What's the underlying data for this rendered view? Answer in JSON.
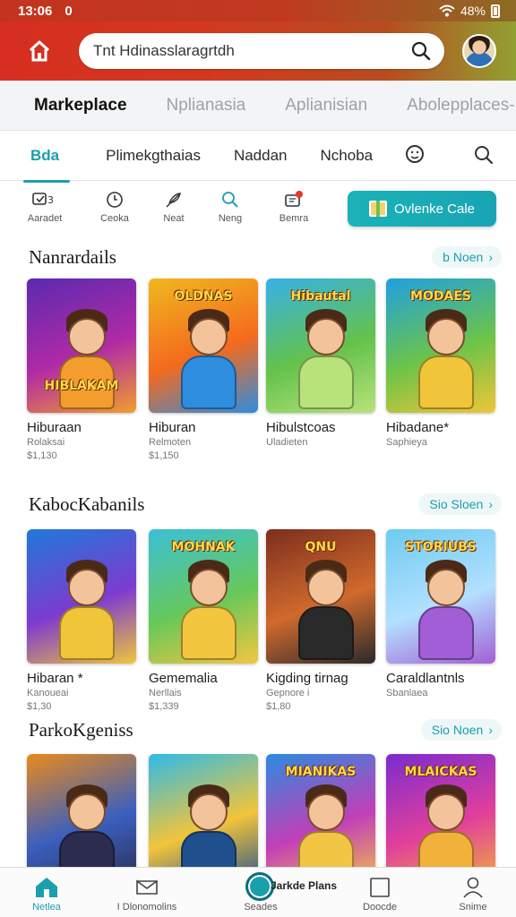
{
  "status_bar": {
    "time": "13:06",
    "signal_label": "0",
    "battery": "48%"
  },
  "search": {
    "value": "Tnt Hdinasslaragrtdh"
  },
  "section_tabs": [
    "Markeplace",
    "Nplianasia",
    "Aplianisian",
    "Abolepplaces-"
  ],
  "category_tabs": [
    "Bda",
    "Plimekgthaias",
    "Naddan",
    "Nchoba"
  ],
  "quick_actions": [
    {
      "label": "Aaradet",
      "icon": "ticket-icon"
    },
    {
      "label": "Ceoka",
      "icon": "clock-icon"
    },
    {
      "label": "Neat",
      "icon": "feather-icon"
    },
    {
      "label": "Neng",
      "icon": "search-icon"
    },
    {
      "label": "Bemra",
      "icon": "notification-icon"
    }
  ],
  "cta": {
    "label": "Ovlenke Cale"
  },
  "sections": [
    {
      "title": "Nanrardails",
      "see_more": "b Noen",
      "cards": [
        {
          "title": "Hiburaan",
          "subtitle": "Rolaksai",
          "price": "$1,130",
          "art": "HIBLAKAM",
          "theme": [
            "#5b2ab0",
            "#b02aa6",
            "#f29d2e"
          ]
        },
        {
          "title": "Hiburan",
          "subtitle": "Relmoten",
          "price": "$1,150",
          "art": "OLDNAS",
          "theme": [
            "#f0b81f",
            "#f46a1d",
            "#2f8de0"
          ]
        },
        {
          "title": "Hibulstcoas",
          "subtitle": "Uladieten",
          "price": "",
          "art": "Hibautal",
          "theme": [
            "#36b1e8",
            "#64c24b",
            "#b8e27a"
          ]
        },
        {
          "title": "Hibadane*",
          "subtitle": "Saphieya",
          "price": "",
          "art": "MODAES",
          "theme": [
            "#1fa0e0",
            "#6cc447",
            "#f0c53a"
          ]
        }
      ]
    },
    {
      "title": "KabocKabanils",
      "see_more": "Sio Sloen",
      "cards": [
        {
          "title": "Hibaran *",
          "subtitle": "Kanoueai",
          "price": "$1,30",
          "art": "",
          "theme": [
            "#1e7ad8",
            "#7d3bd1",
            "#f0c53a"
          ]
        },
        {
          "title": "Gememalia",
          "subtitle": "Nerllais",
          "price": "$1,339",
          "art": "MOHNAK",
          "theme": [
            "#3cc0d8",
            "#66c85a",
            "#f3c640"
          ]
        },
        {
          "title": "Kigding tirnag",
          "subtitle": "Gepnore i",
          "price": "$1,80",
          "art": "QNU",
          "theme": [
            "#7d2e1e",
            "#d06a2d",
            "#2a2a2a"
          ]
        },
        {
          "title": "Caraldlantnls",
          "subtitle": "Sbanlaea",
          "price": "",
          "art": "STORIUBS",
          "theme": [
            "#6ccbf0",
            "#b3e0ff",
            "#a15ed6"
          ]
        }
      ]
    },
    {
      "title": "ParkoKgeniss",
      "see_more": "Sio Noen",
      "cards": [
        {
          "title": "",
          "subtitle": "",
          "price": "",
          "art": "",
          "theme": [
            "#e98a1c",
            "#3a5fbf",
            "#2c2c50"
          ]
        },
        {
          "title": "",
          "subtitle": "",
          "price": "",
          "art": "",
          "theme": [
            "#2dbbe8",
            "#f2c43a",
            "#1f4f8d"
          ]
        },
        {
          "title": "",
          "subtitle": "",
          "price": "",
          "art": "MIANIKAS",
          "theme": [
            "#2b8be0",
            "#c23fb8",
            "#f3c545"
          ]
        },
        {
          "title": "",
          "subtitle": "",
          "price": "",
          "art": "MLAICKAS",
          "theme": [
            "#7a2bd0",
            "#e2409b",
            "#f2b13a"
          ]
        }
      ]
    }
  ],
  "bottom_nav": [
    {
      "label": "Netlea",
      "icon": "home-icon"
    },
    {
      "label": "I Dlonomolins",
      "icon": "envelope-icon"
    },
    {
      "label": "Seades",
      "icon": "explore-icon"
    },
    {
      "label": "Doocde",
      "icon": "square-icon"
    },
    {
      "label": "Snime",
      "icon": "profile-icon"
    }
  ],
  "center_button_label": "Jarkde Plans",
  "colors": {
    "accent": "#1a9fad",
    "header_start": "#d62e21",
    "header_end": "#92a032"
  }
}
